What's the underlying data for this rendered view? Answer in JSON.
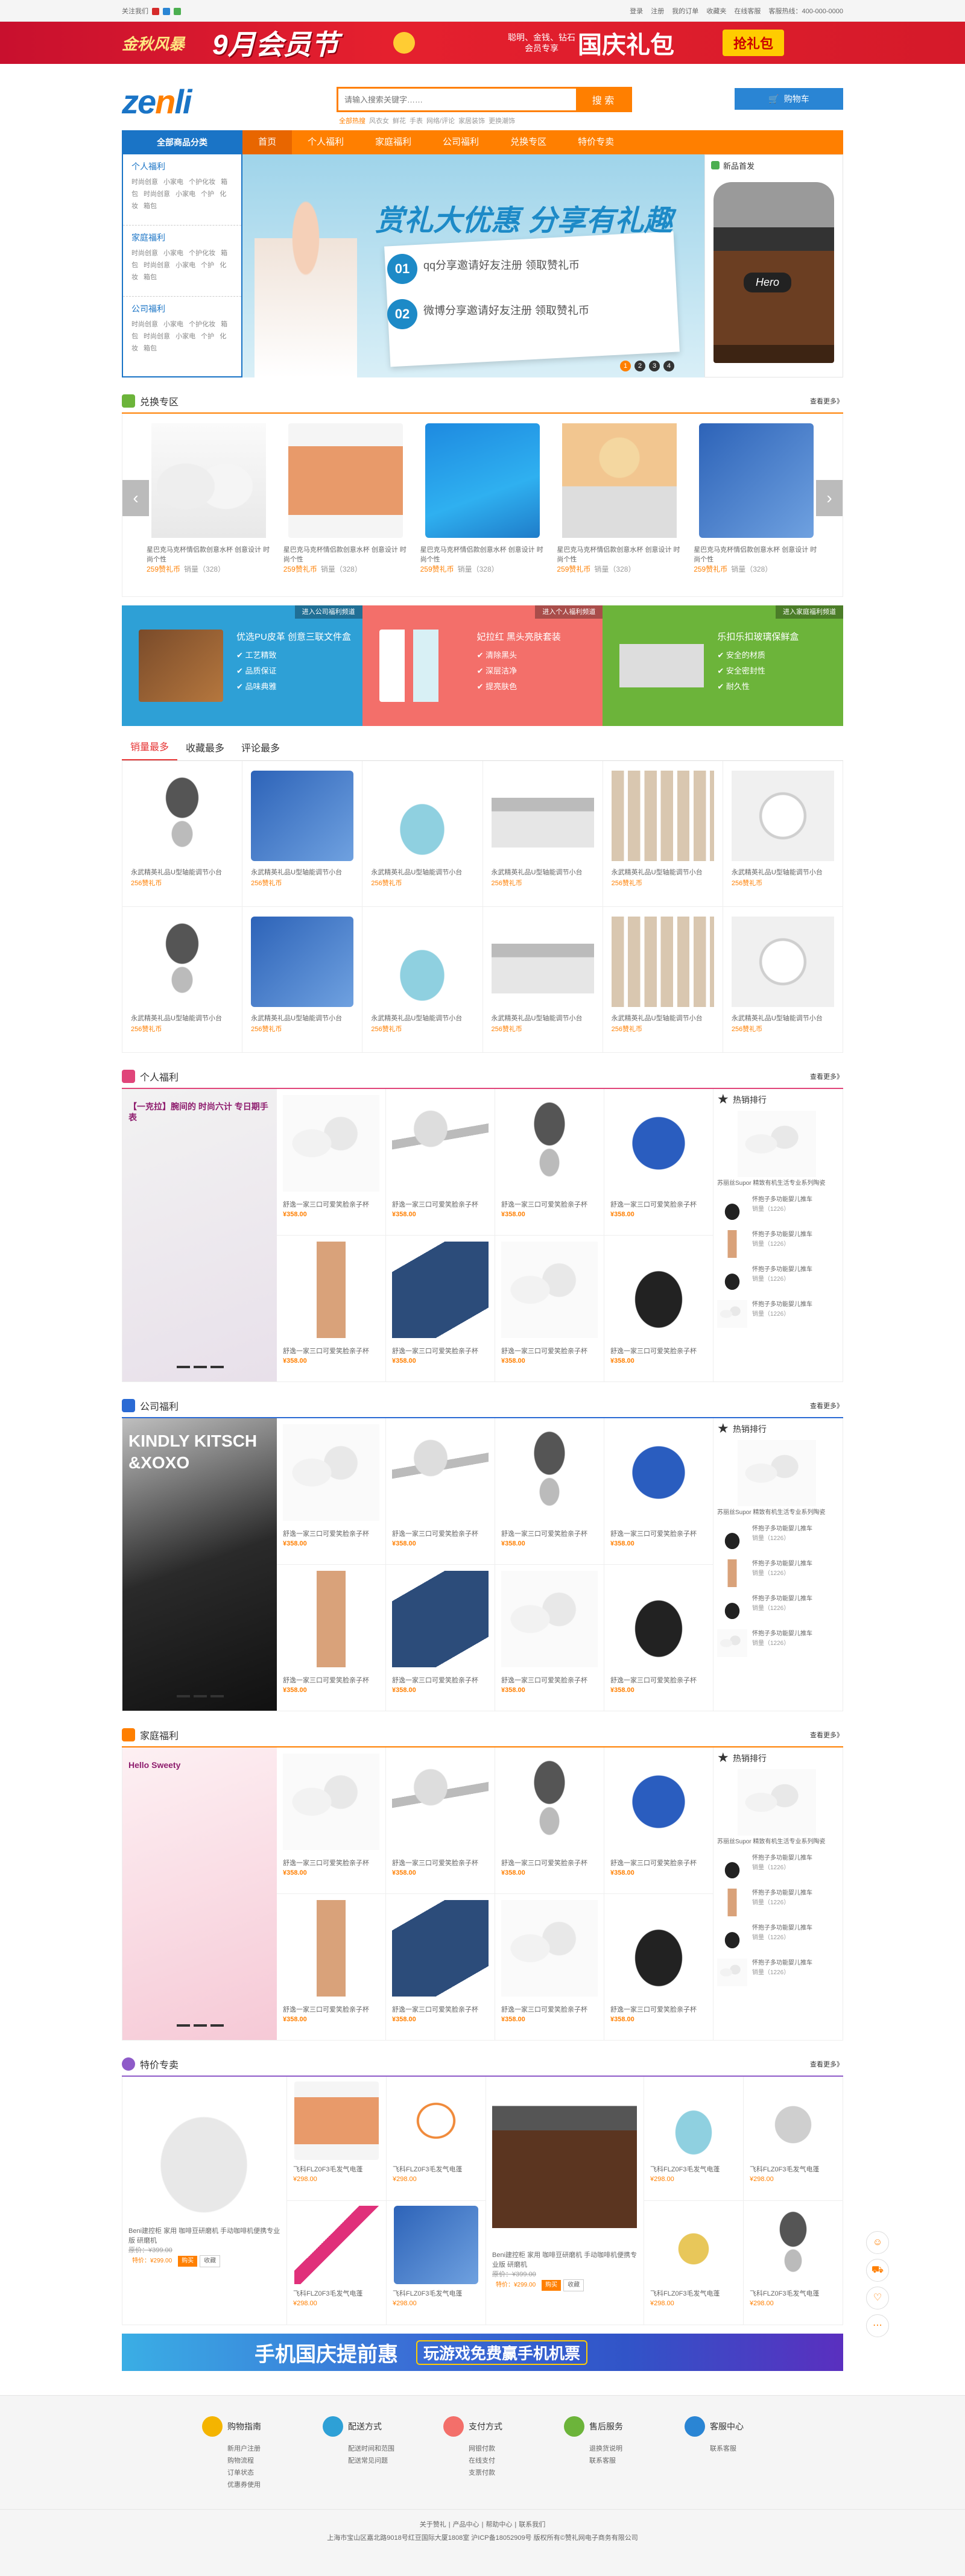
{
  "topbar": {
    "left": "关注我们",
    "right": [
      "登录",
      "注册",
      "我的订单",
      "收藏夹",
      "在线客服",
      "客服热线：400-000-0000"
    ]
  },
  "banner": {
    "logo": "金秋风暴",
    "main": "9月会员节",
    "small": "聪明、金钱、钻石会员专享",
    "big": "国庆礼包",
    "btn": "抢礼包"
  },
  "header": {
    "logo_a": "ze",
    "logo_b": "n",
    "logo_c": "li",
    "search_placeholder": "请输入搜索关键字……",
    "search_btn": "搜 索",
    "hot": [
      "全部热搜",
      "风衣女",
      "鲜花",
      "手表",
      "网络/评论",
      "家居装饰",
      "更换潮饰"
    ],
    "cart": "购物车"
  },
  "nav": {
    "all": "全部商品分类",
    "items": [
      "首页",
      "个人福利",
      "家庭福利",
      "公司福利",
      "兑换专区",
      "特价专卖"
    ]
  },
  "cats": [
    {
      "title": "个人福利",
      "text": "时尚创意 小家电 个护化妆 箱包 时尚创意 小家电 个护 化妆 箱包"
    },
    {
      "title": "家庭福利",
      "text": "时尚创意 小家电 个护化妆 箱包 时尚创意 小家电 个护 化妆 箱包"
    },
    {
      "title": "公司福利",
      "text": "时尚创意 小家电 个护化妆 箱包 时尚创意 小家电 个护 化妆 箱包"
    }
  ],
  "slider": {
    "title": "赏礼大优惠 分享有礼趣",
    "l1": "qq分享邀请好友注册 领取赞礼币",
    "l2": "微博分享邀请好友注册 领取赞礼币",
    "n1": "01",
    "n2": "02",
    "dots": [
      "1",
      "2",
      "3",
      "4"
    ]
  },
  "newp": {
    "title": "新品首发"
  },
  "exchange": {
    "title": "兑换专区",
    "more": "查看更多》",
    "items": [
      {
        "name": "星巴克马克杯情侣款创意水杯 创意设计 时尚个性",
        "price": "259赞礼币",
        "sold": "销量（328）"
      },
      {
        "name": "星巴克马克杯情侣款创意水杯 创意设计 时尚个性",
        "price": "259赞礼币",
        "sold": "销量（328）"
      },
      {
        "name": "星巴克马克杯情侣款创意水杯 创意设计 时尚个性",
        "price": "259赞礼币",
        "sold": "销量（328）"
      },
      {
        "name": "星巴克马克杯情侣款创意水杯 创意设计 时尚个性",
        "price": "259赞礼币",
        "sold": "销量（328）"
      },
      {
        "name": "星巴克马克杯情侣款创意水杯 创意设计 时尚个性",
        "price": "259赞礼币",
        "sold": "销量（328）"
      }
    ]
  },
  "promos": [
    {
      "tag": "进入公司福利频道",
      "title": "优选PU皮革 创意三联文件盒",
      "items": [
        "✔ 工艺精致",
        "✔ 品质保证",
        "✔ 品味典雅"
      ],
      "color": "#2ea0d6"
    },
    {
      "tag": "进入个人福利频道",
      "title": "妃拉红 黑头亮肤套装",
      "items": [
        "✔ 清除黑头",
        "✔ 深层洁净",
        "✔ 提亮肤色"
      ],
      "color": "#f36f6a"
    },
    {
      "tag": "进入家庭福利频道",
      "title": "乐扣乐扣玻璃保鲜盒",
      "items": [
        "✔ 安全的材质",
        "✔ 安全密封性",
        "✔ 耐久性"
      ],
      "color": "#6cb43a"
    }
  ],
  "rank_tabs": [
    "销量最多",
    "收藏最多",
    "评论最多"
  ],
  "rank_items": {
    "name": "永武精英礼品U型轴能调节小台",
    "price": "256赞礼币"
  },
  "floors": [
    {
      "title": "个人福利",
      "more": "查看更多》",
      "color": "#e0457a",
      "banner": "【一克拉】腕间的 时尚六计 专日期手表",
      "rank": "热销排行"
    },
    {
      "title": "公司福利",
      "more": "查看更多》",
      "color": "#2a6ad4",
      "banner": "KINDLY KITSCH &XOXO",
      "rank": "热销排行"
    },
    {
      "title": "家庭福利",
      "more": "查看更多》",
      "color": "#ff7f00",
      "banner": "Hello Sweety",
      "rank": "热销排行"
    }
  ],
  "floor_item": {
    "name": "舒逸一家三口可爱笑脸亲子杯",
    "price": "¥358.00"
  },
  "rank_first": "苏丽丝Supor 精致有机生活专业系列陶瓷",
  "rank_item": {
    "name": "怀抱子多功能婴儿推车",
    "sold": "销量（1226）"
  },
  "special": {
    "title": "特价专卖",
    "more": "查看更多》",
    "big_name": "Beni建控柜 家用 咖啡豆研磨机 手动咖啡机便携专业版 研磨机",
    "orig": "原价：¥399.00",
    "price": "特价：¥299.00",
    "btn1": "购买",
    "btn2": "收藏",
    "item_name": "飞科FLZ0F3毛发气电蓬",
    "item_price": "¥298.00"
  },
  "adbar": {
    "t1": "手机国庆提前惠",
    "t2": "玩游戏免费赢手机机票"
  },
  "footer": {
    "cols": [
      {
        "title": "购物指南",
        "items": [
          "新用户注册",
          "购物流程",
          "订单状态",
          "优惠券使用"
        ],
        "color": "#f4b400"
      },
      {
        "title": "配送方式",
        "items": [
          "配送时间和范围",
          "配送常见问题"
        ],
        "color": "#2ea0d6"
      },
      {
        "title": "支付方式",
        "items": [
          "网银付款",
          "在线支付",
          "支票付款"
        ],
        "color": "#f36f6a"
      },
      {
        "title": "售后服务",
        "items": [
          "退换货说明",
          "联系客服"
        ],
        "color": "#6cb43a"
      },
      {
        "title": "客服中心",
        "items": [
          "联系客服"
        ],
        "color": "#2a85d4"
      }
    ],
    "links": [
      "关于赞礼",
      "产品中心",
      "帮助中心",
      "联系我们"
    ],
    "copy": "上海市宝山区嘉北路9018号红豆国际大厦1808室 沪ICP备18052909号 版权所有©赞礼网电子商务有限公司"
  }
}
